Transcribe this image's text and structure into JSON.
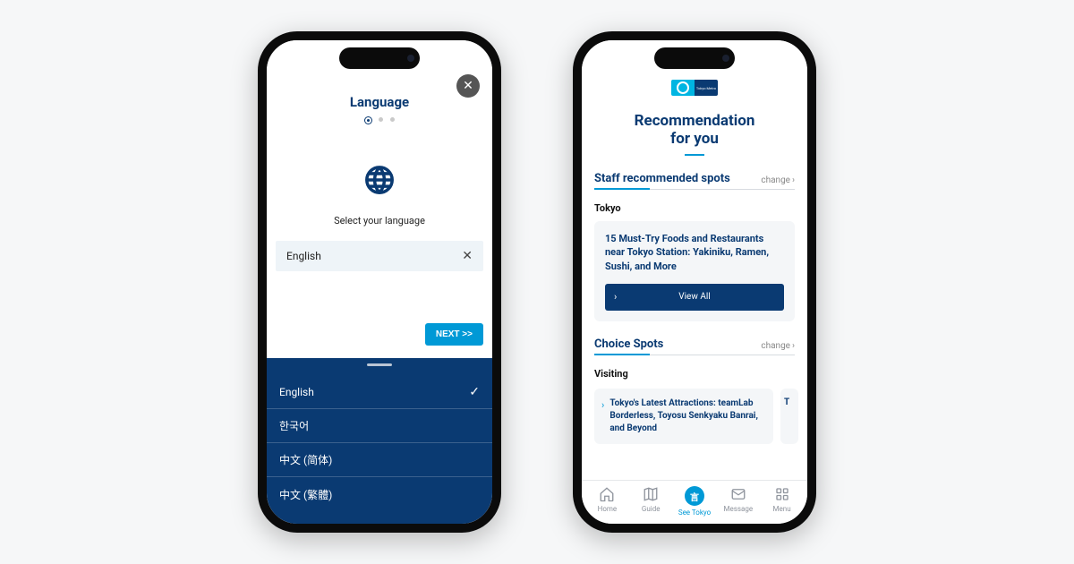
{
  "phone1": {
    "title": "Language",
    "select_text": "Select your language",
    "selected_language": "English",
    "next_label": "NEXT >>",
    "options": [
      {
        "label": "English",
        "checked": true
      },
      {
        "label": "한국어",
        "checked": false
      },
      {
        "label": "中文 (简体)",
        "checked": false
      },
      {
        "label": "中文 (繁體)",
        "checked": false
      }
    ]
  },
  "phone2": {
    "logo_text": "Tokyo Metro",
    "title_line1": "Recommendation",
    "title_line2": "for you",
    "section1": {
      "title": "Staff recommended spots",
      "change": "change",
      "sub": "Tokyo",
      "card_title": "15 Must-Try Foods and Restaurants near Tokyo Station: Yakiniku, Ramen, Sushi, and More",
      "view_all": "View All"
    },
    "section2": {
      "title": "Choice Spots",
      "change": "change",
      "sub": "Visiting",
      "item1": "Tokyo's Latest Attractions: teamLab Borderless, Toyosu Senkyaku Banrai, and Beyond",
      "peek": "T"
    },
    "tabs": [
      {
        "label": "Home"
      },
      {
        "label": "Guide"
      },
      {
        "label": "See Tokyo"
      },
      {
        "label": "Message"
      },
      {
        "label": "Menu"
      }
    ]
  }
}
